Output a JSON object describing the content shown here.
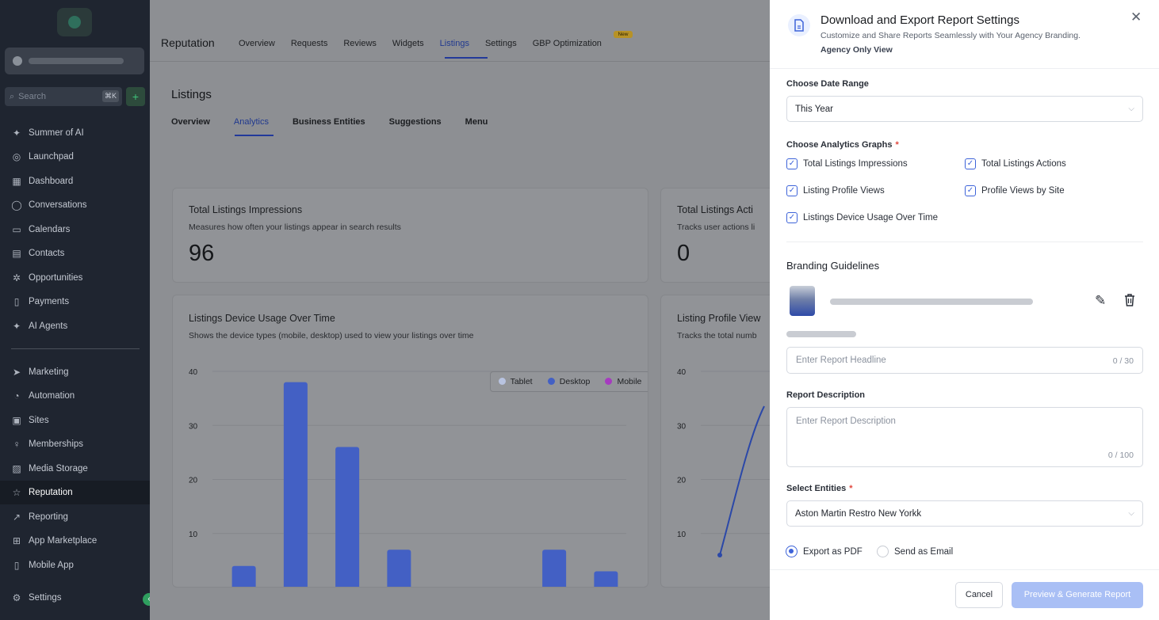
{
  "sidebar": {
    "search_placeholder": "Search",
    "search_shortcut": "⌘K",
    "add_label": "+",
    "items": [
      {
        "label": "Summer of AI",
        "icon": "sparkle-icon"
      },
      {
        "label": "Launchpad",
        "icon": "launchpad-icon"
      },
      {
        "label": "Dashboard",
        "icon": "dashboard-icon"
      },
      {
        "label": "Conversations",
        "icon": "chat-icon"
      },
      {
        "label": "Calendars",
        "icon": "calendar-icon"
      },
      {
        "label": "Contacts",
        "icon": "contacts-icon"
      },
      {
        "label": "Opportunities",
        "icon": "opportunities-icon"
      },
      {
        "label": "Payments",
        "icon": "payments-icon"
      },
      {
        "label": "AI Agents",
        "icon": "sparkle-icon"
      },
      {
        "label": "Marketing",
        "icon": "send-icon"
      },
      {
        "label": "Automation",
        "icon": "automation-icon"
      },
      {
        "label": "Sites",
        "icon": "sites-icon"
      },
      {
        "label": "Memberships",
        "icon": "badge-icon"
      },
      {
        "label": "Media Storage",
        "icon": "image-icon"
      },
      {
        "label": "Reputation",
        "icon": "star-icon"
      },
      {
        "label": "Reporting",
        "icon": "trend-icon"
      },
      {
        "label": "App Marketplace",
        "icon": "grid-icon"
      },
      {
        "label": "Mobile App",
        "icon": "phone-icon"
      },
      {
        "label": "Settings",
        "icon": "gear-icon"
      }
    ],
    "active": "Reputation"
  },
  "topbar": {
    "brand": "Reputation",
    "tabs": [
      "Overview",
      "Requests",
      "Reviews",
      "Widgets",
      "Listings",
      "Settings",
      "GBP Optimization"
    ],
    "active_tab": "Listings",
    "new_badge": "New"
  },
  "page": {
    "title": "Listings",
    "subtabs": [
      "Overview",
      "Analytics",
      "Business Entities",
      "Suggestions",
      "Menu"
    ],
    "active_subtab": "Analytics"
  },
  "cards": {
    "impressions": {
      "title": "Total Listings Impressions",
      "desc": "Measures how often your listings appear in search results",
      "value": "96"
    },
    "actions": {
      "title": "Total Listings Acti",
      "desc": "Tracks user actions li",
      "value": "0"
    },
    "device": {
      "title": "Listings Device Usage Over Time",
      "desc": "Shows the device types (mobile, desktop) used to view your listings over time"
    },
    "profile": {
      "title": "Listing Profile View",
      "desc": "Tracks the total numb"
    }
  },
  "chart_data": [
    {
      "type": "bar",
      "title": "Listings Device Usage Over Time",
      "ylim": [
        0,
        40
      ],
      "yticks": [
        "40",
        "30",
        "20",
        "10"
      ],
      "legend": [
        "Tablet",
        "Desktop",
        "Mobile"
      ],
      "legend_colors": [
        "#b8c3e0",
        "#4360c4",
        "#a63bc0"
      ],
      "series": [
        {
          "name": "Desktop",
          "values": [
            4,
            38,
            26,
            7,
            0,
            0,
            7,
            3
          ]
        }
      ]
    },
    {
      "type": "line",
      "title": "Listing Profile View",
      "ylim": [
        0,
        40
      ],
      "yticks": [
        "40",
        "30",
        "20",
        "10"
      ]
    }
  ],
  "panel": {
    "title": "Download and Export Report Settings",
    "subtitle": "Customize and Share Reports Seamlessly with Your Agency Branding.",
    "agency": "Agency Only View",
    "close": "✕",
    "date_label": "Choose Date Range",
    "date_value": "This Year",
    "graphs_label": "Choose Analytics Graphs",
    "required_mark": "*",
    "graphs": [
      "Total Listings Impressions",
      "Total Listings Actions",
      "Listing Profile Views",
      "Profile Views by Site",
      "Listings Device Usage Over Time"
    ],
    "branding_title": "Branding Guidelines",
    "headline_placeholder": "Enter Report Headline",
    "headline_count": "0 / 30",
    "description_label": "Report Description",
    "description_placeholder": "Enter Report Description",
    "description_count": "0 / 100",
    "entities_label": "Select Entities",
    "entities_value": "Aston Martin Restro New Yorkk",
    "export_pdf": "Export as PDF",
    "send_email": "Send as Email",
    "cancel": "Cancel",
    "generate": "Preview & Generate Report"
  }
}
